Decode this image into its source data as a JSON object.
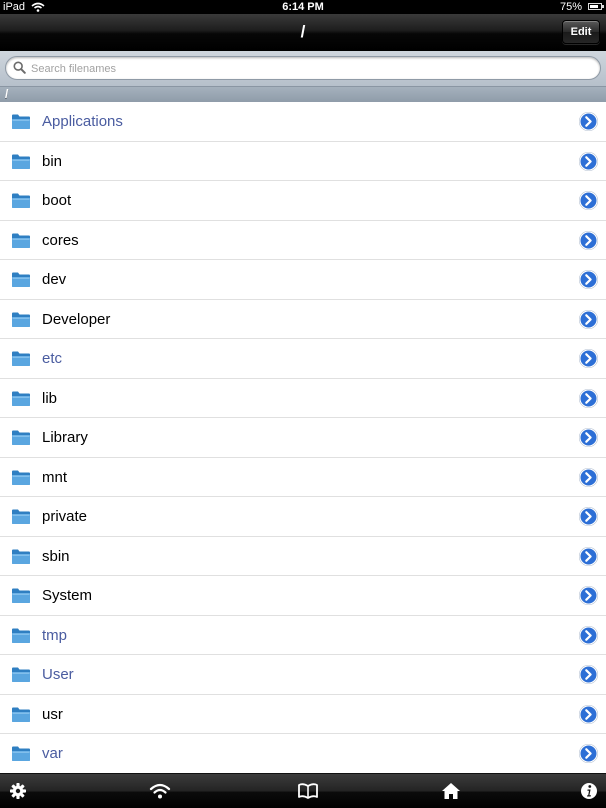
{
  "status_bar": {
    "carrier": "iPad",
    "time": "6:14 PM",
    "battery_text": "75%",
    "battery_level": 0.75
  },
  "nav": {
    "title": "/",
    "edit_label": "Edit"
  },
  "search": {
    "placeholder": "Search filenames",
    "value": ""
  },
  "path_header": "/",
  "colors": {
    "symlink_text": "#4a5ca0",
    "folder_blue": "#3d8fcf",
    "disclosure_blue": "#2d6fd6"
  },
  "items": [
    {
      "name": "Applications",
      "symlink": true
    },
    {
      "name": "bin",
      "symlink": false
    },
    {
      "name": "boot",
      "symlink": false
    },
    {
      "name": "cores",
      "symlink": false
    },
    {
      "name": "dev",
      "symlink": false
    },
    {
      "name": "Developer",
      "symlink": false
    },
    {
      "name": "etc",
      "symlink": true
    },
    {
      "name": "lib",
      "symlink": false
    },
    {
      "name": "Library",
      "symlink": false
    },
    {
      "name": "mnt",
      "symlink": false
    },
    {
      "name": "private",
      "symlink": false
    },
    {
      "name": "sbin",
      "symlink": false
    },
    {
      "name": "System",
      "symlink": false
    },
    {
      "name": "tmp",
      "symlink": true
    },
    {
      "name": "User",
      "symlink": true
    },
    {
      "name": "usr",
      "symlink": false
    },
    {
      "name": "var",
      "symlink": true
    }
  ],
  "tabbar": {
    "icons": [
      "gear-icon",
      "wifi-icon",
      "book-icon",
      "home-icon",
      "info-icon"
    ]
  }
}
